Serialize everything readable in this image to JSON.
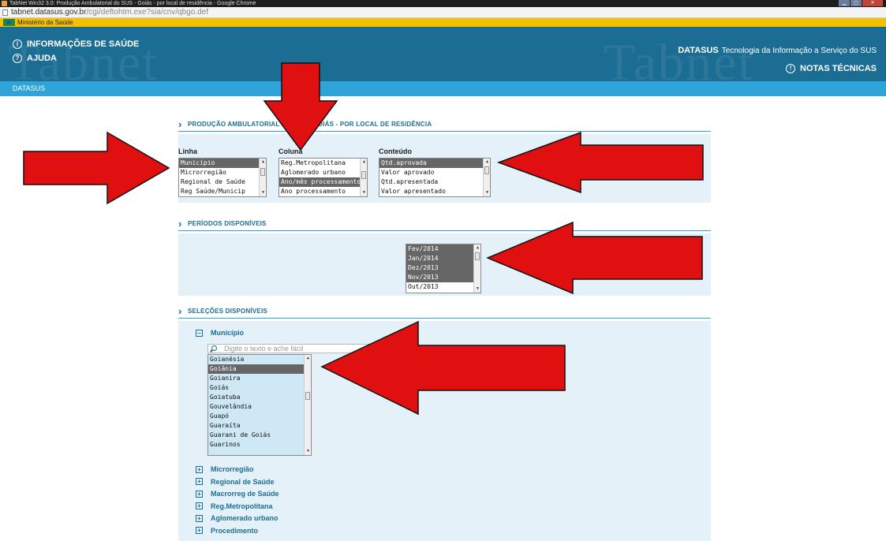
{
  "browser": {
    "title": "TabNet Win32 3.0: Produção Ambulatorial do SUS - Goiás - por local de residência - Google Chrome",
    "url_domain": "tabnet.datasus.gov.br",
    "url_path": "/cgi/deftohtm.exe?sia/cnv/qbgo.def"
  },
  "ministerio": {
    "label": "Ministério da Saúde"
  },
  "header": {
    "watermark": "Tabnet",
    "info_label": "INFORMAÇÕES DE SAÚDE",
    "help_label": "AJUDA",
    "brand": "DATASUS",
    "tagline": "Tecnologia da Informação a Serviço do SUS",
    "notas_label": "NOTAS TÉCNICAS"
  },
  "nav": {
    "datasus": "DATASUS"
  },
  "section1": {
    "title": "PRODUÇÃO AMBULATORIAL DO SUS - GOIÁS - POR LOCAL DE RESIDÊNCIA",
    "linha": {
      "label": "Linha",
      "options": [
        "Município",
        "Microrregião",
        "Regional de Saúde",
        "Reg Saúde/Municip"
      ],
      "selected": [
        0
      ]
    },
    "coluna": {
      "label": "Coluna",
      "options": [
        "Reg.Metropolitana",
        "Aglomerado urbano",
        "Ano/mês processamento",
        "Ano processamento"
      ],
      "selected": [
        2
      ]
    },
    "conteudo": {
      "label": "Conteúdo",
      "options": [
        "Qtd.aprovada",
        "Valor aprovado",
        "Qtd.apresentada",
        "Valor apresentado"
      ],
      "selected": [
        0
      ]
    }
  },
  "section2": {
    "title": "PERÍODOS DISPONÍVEIS",
    "periodos": {
      "options": [
        "Fev/2014",
        "Jan/2014",
        "Dez/2013",
        "Nov/2013",
        "Out/2013"
      ],
      "selected": [
        0,
        1,
        2,
        3
      ]
    }
  },
  "section3": {
    "title": "SELEÇÕES DISPONÍVEIS",
    "municipio": {
      "label": "Município",
      "toggle": "−",
      "search_placeholder": "Digite o texto e ache fácil",
      "options": [
        "Goianésia",
        "Goiânia",
        "Goianira",
        "Goiás",
        "Goiatuba",
        "Gouvelândia",
        "Guapó",
        "Guaraíta",
        "Guarani de Goiás",
        "Guarinos"
      ],
      "selected": [
        1
      ]
    },
    "collapsed": [
      {
        "label": "Microrregião",
        "toggle": "+"
      },
      {
        "label": "Regional de Saúde",
        "toggle": "+"
      },
      {
        "label": "Macrorreg de Saúde",
        "toggle": "+"
      },
      {
        "label": "Reg.Metropolitana",
        "toggle": "+"
      },
      {
        "label": "Aglomerado urbano",
        "toggle": "+"
      },
      {
        "label": "Procedimento",
        "toggle": "+"
      }
    ]
  },
  "colors": {
    "header_bg": "#1c6d93",
    "nav_bg": "#2ea4d8",
    "ministerio_bg": "#f3c100",
    "arrow": "#e01010",
    "selected_bg": "#666666"
  }
}
